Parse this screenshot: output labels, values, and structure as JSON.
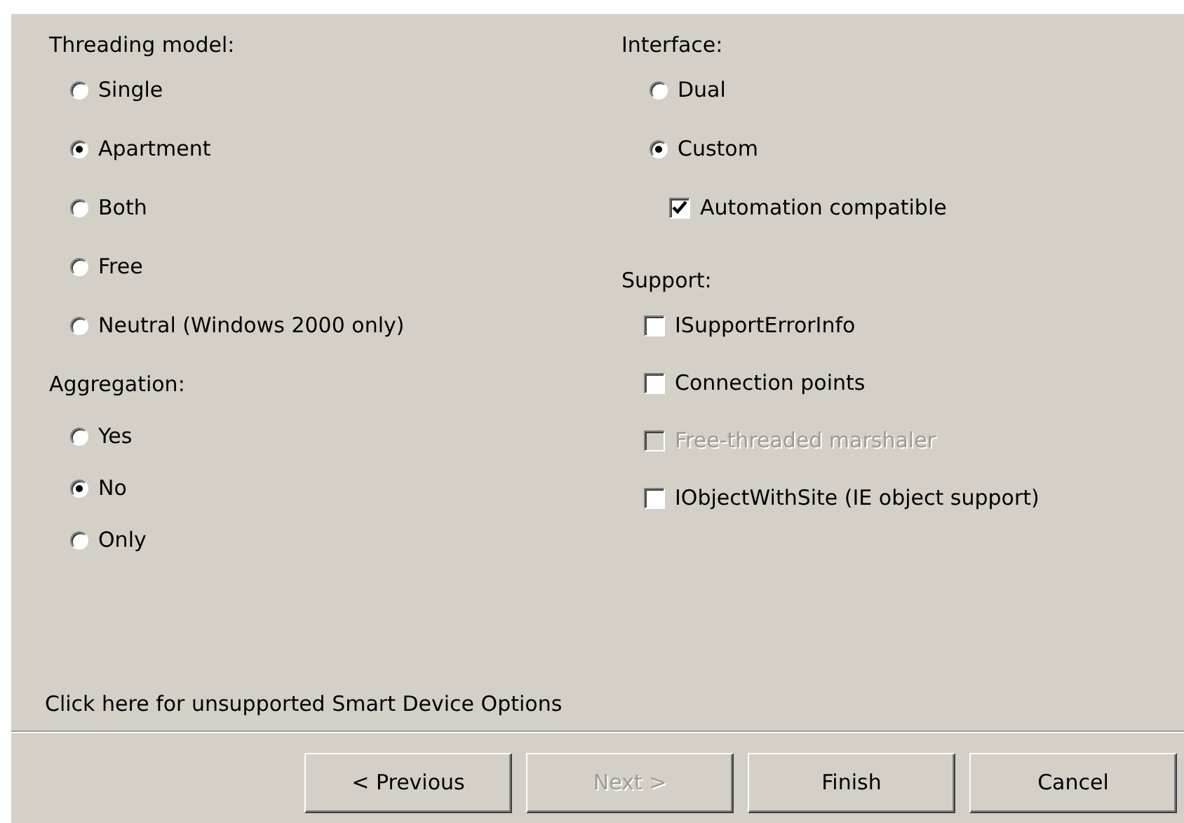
{
  "threading_model": {
    "label": "Threading model:",
    "options": [
      {
        "label": "Single",
        "selected": false
      },
      {
        "label": "Apartment",
        "selected": true
      },
      {
        "label": "Both",
        "selected": false
      },
      {
        "label": "Free",
        "selected": false
      },
      {
        "label": "Neutral (Windows 2000 only)",
        "selected": false
      }
    ]
  },
  "aggregation": {
    "label": "Aggregation:",
    "options": [
      {
        "label": "Yes",
        "selected": false
      },
      {
        "label": "No",
        "selected": true
      },
      {
        "label": "Only",
        "selected": false
      }
    ]
  },
  "interface": {
    "label": "Interface:",
    "options": [
      {
        "label": "Dual",
        "selected": false
      },
      {
        "label": "Custom",
        "selected": true
      }
    ],
    "sub_option": {
      "label": "Automation compatible",
      "checked": true,
      "disabled": false
    }
  },
  "support": {
    "label": "Support:",
    "options": [
      {
        "label": "ISupportErrorInfo",
        "checked": false,
        "disabled": false
      },
      {
        "label": "Connection points",
        "checked": false,
        "disabled": false
      },
      {
        "label": "Free-threaded marshaler",
        "checked": false,
        "disabled": true
      },
      {
        "label": "IObjectWithSite (IE object support)",
        "checked": false,
        "disabled": false
      }
    ]
  },
  "smart_device_link": "Click here for unsupported Smart Device Options",
  "buttons": [
    {
      "label": "< Previous",
      "disabled": false
    },
    {
      "label": "Next >",
      "disabled": true
    },
    {
      "label": "Finish",
      "disabled": false
    },
    {
      "label": "Cancel",
      "disabled": false
    }
  ]
}
